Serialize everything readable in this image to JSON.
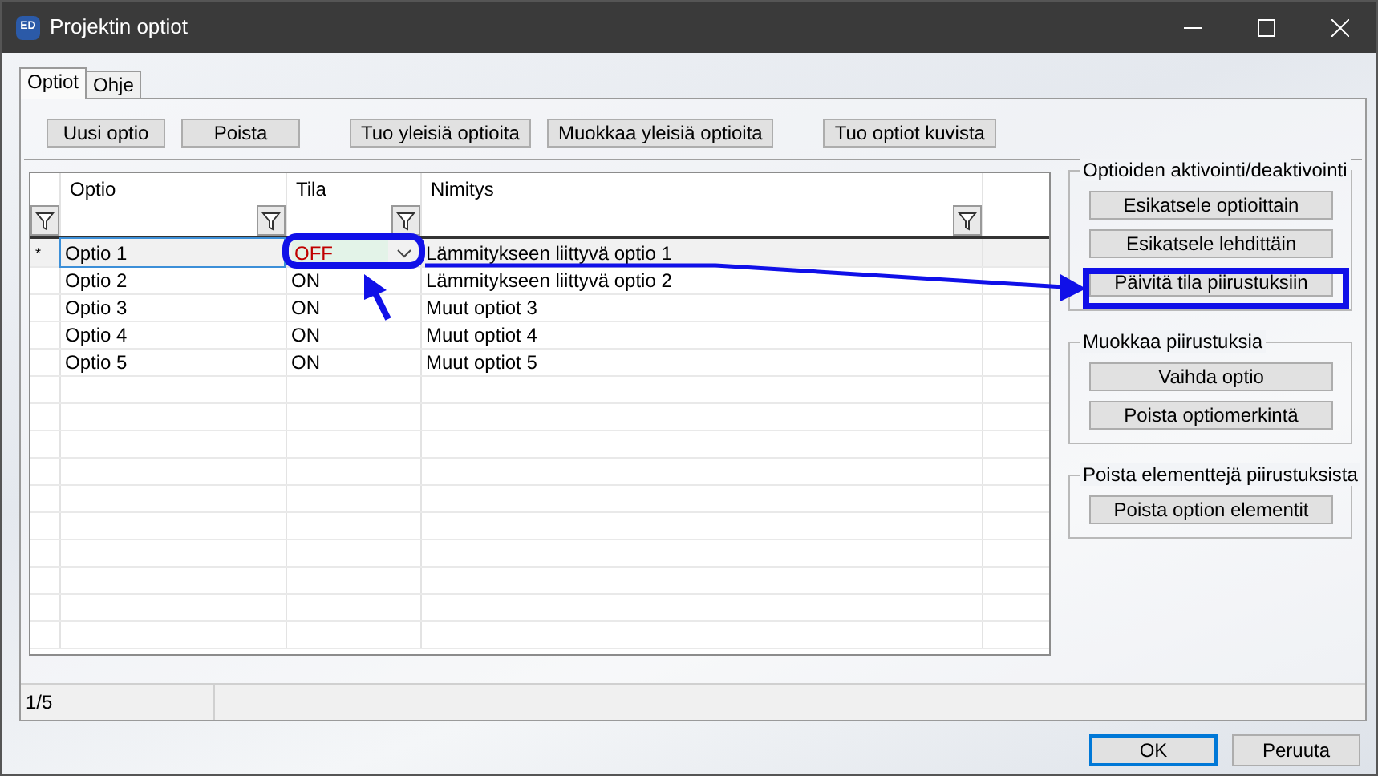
{
  "window": {
    "title": "Projektin optiot",
    "icon_label": "ED"
  },
  "tabs": [
    {
      "label": "Optiot",
      "selected": true
    },
    {
      "label": "Ohje",
      "selected": false
    }
  ],
  "toolbar": [
    [
      "Uusi optio",
      "Poista"
    ],
    [
      "Tuo yleisiä optioita",
      "Muokkaa yleisiä optioita"
    ],
    [
      "Tuo optiot kuvista"
    ]
  ],
  "table": {
    "columns": [
      "Optio",
      "Tila",
      "Nimitys"
    ],
    "rows": [
      {
        "marker": "*",
        "selected": true,
        "editing": true,
        "optio": "Optio 1",
        "tila": "OFF",
        "color": "#c00000",
        "nimitys": "Lämmitykseen liittyvä optio 1"
      },
      {
        "selected": false,
        "editing": false,
        "optio": "Optio 2",
        "tila": "ON",
        "color": "#000000",
        "nimitys": "Lämmitykseen liittyvä optio 2"
      },
      {
        "selected": false,
        "editing": false,
        "optio": "Optio 3",
        "tila": "ON",
        "color": "#000000",
        "nimitys": "Muut optiot 3"
      },
      {
        "selected": false,
        "editing": false,
        "optio": "Optio 4",
        "tila": "ON",
        "color": "#000000",
        "nimitys": "Muut optiot 4"
      },
      {
        "selected": false,
        "editing": false,
        "optio": "Optio 5",
        "tila": "ON",
        "color": "#000000",
        "nimitys": "Muut optiot 5"
      }
    ]
  },
  "groups": [
    {
      "title": "Optioiden aktivointi/deaktivointi",
      "buttons": [
        "Esikatsele optioittain",
        "Esikatsele lehdittäin",
        "Päivitä tila piirustuksiin"
      ]
    },
    {
      "title": "Muokkaa piirustuksia",
      "buttons": [
        "Vaihda optio",
        "Poista optiomerkintä"
      ]
    },
    {
      "title": "Poista elementtejä piirustuksista",
      "buttons": [
        "Poista option elementit"
      ]
    }
  ],
  "status_bar": "1/5",
  "buttons": [
    {
      "label": "OK",
      "default": true
    },
    {
      "label": "Peruuta",
      "default": false
    }
  ]
}
